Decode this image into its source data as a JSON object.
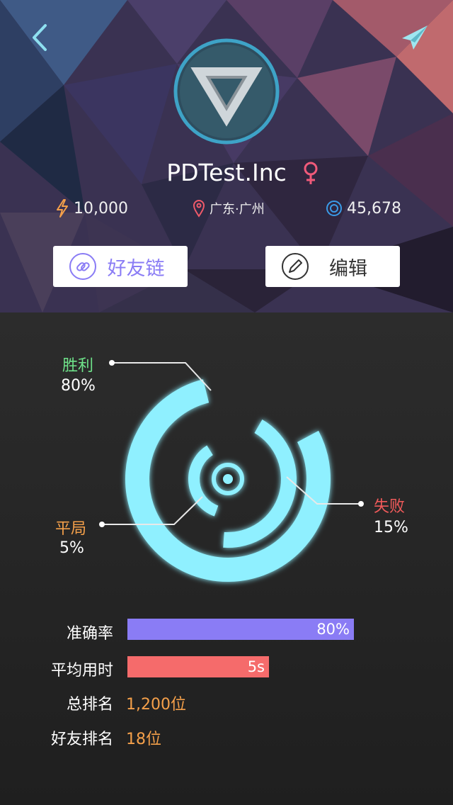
{
  "nav": {
    "back_icon": "chevron-left-icon",
    "share_icon": "paper-plane-icon"
  },
  "profile": {
    "name": "PDTest.Inc",
    "gender_icon": "female-icon",
    "avatar_icon": "impossible-triangle-logo"
  },
  "stats": {
    "energy": "10,000",
    "location": "广东·广州",
    "coins": "45,678"
  },
  "buttons": {
    "friend_link": "好友链",
    "edit": "编辑"
  },
  "chart_data": {
    "type": "donut",
    "series": [
      {
        "name": "胜利",
        "value": 80,
        "label": "80%",
        "color": "#6fe38a"
      },
      {
        "name": "失败",
        "value": 15,
        "label": "15%",
        "color": "#f05a5a"
      },
      {
        "name": "平局",
        "value": 5,
        "label": "5%",
        "color": "#f5a04a"
      }
    ]
  },
  "metrics": [
    {
      "label": "准确率",
      "value": 80,
      "value_label": "80%",
      "color": "#8a7cf5"
    },
    {
      "label": "平均用时",
      "value": 5,
      "value_label": "5s",
      "color": "#f56b6b"
    }
  ],
  "ranks": [
    {
      "label": "总排名",
      "value": "1,200位"
    },
    {
      "label": "好友排名",
      "value": "18位"
    }
  ],
  "colors": {
    "accent_purple": "#8a7cf5",
    "accent_orange": "#f5a04a",
    "ring": "#8ff0ff"
  }
}
